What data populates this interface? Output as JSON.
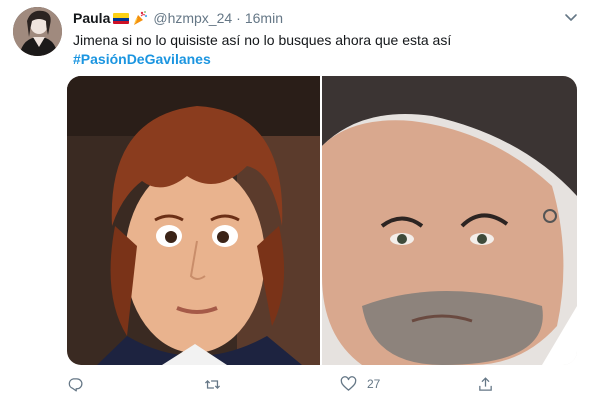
{
  "tweet": {
    "author": {
      "display_name": "Paula",
      "handle": "@hzmpx_24",
      "flag_icon": "colombia-flag-icon",
      "emoji_icon": "party-popper-icon"
    },
    "separator": "·",
    "time": "16min",
    "text": "Jimena si no lo quisiste así no lo busques ahora que esta así",
    "hashtag": "#PasiónDeGavilanes",
    "media": [
      {
        "name": "photo-left",
        "description": "man with long reddish hair, surprised look"
      },
      {
        "name": "photo-right",
        "description": "bearded man with earring, intense look"
      }
    ],
    "actions": {
      "reply": {
        "icon": "reply-icon",
        "count": ""
      },
      "retweet": {
        "icon": "retweet-icon",
        "count": ""
      },
      "like": {
        "icon": "heart-icon",
        "count": "27"
      },
      "share": {
        "icon": "share-icon",
        "count": ""
      }
    },
    "colors": {
      "link": "#1b95e0",
      "muted": "#657786",
      "text": "#14171a"
    }
  }
}
